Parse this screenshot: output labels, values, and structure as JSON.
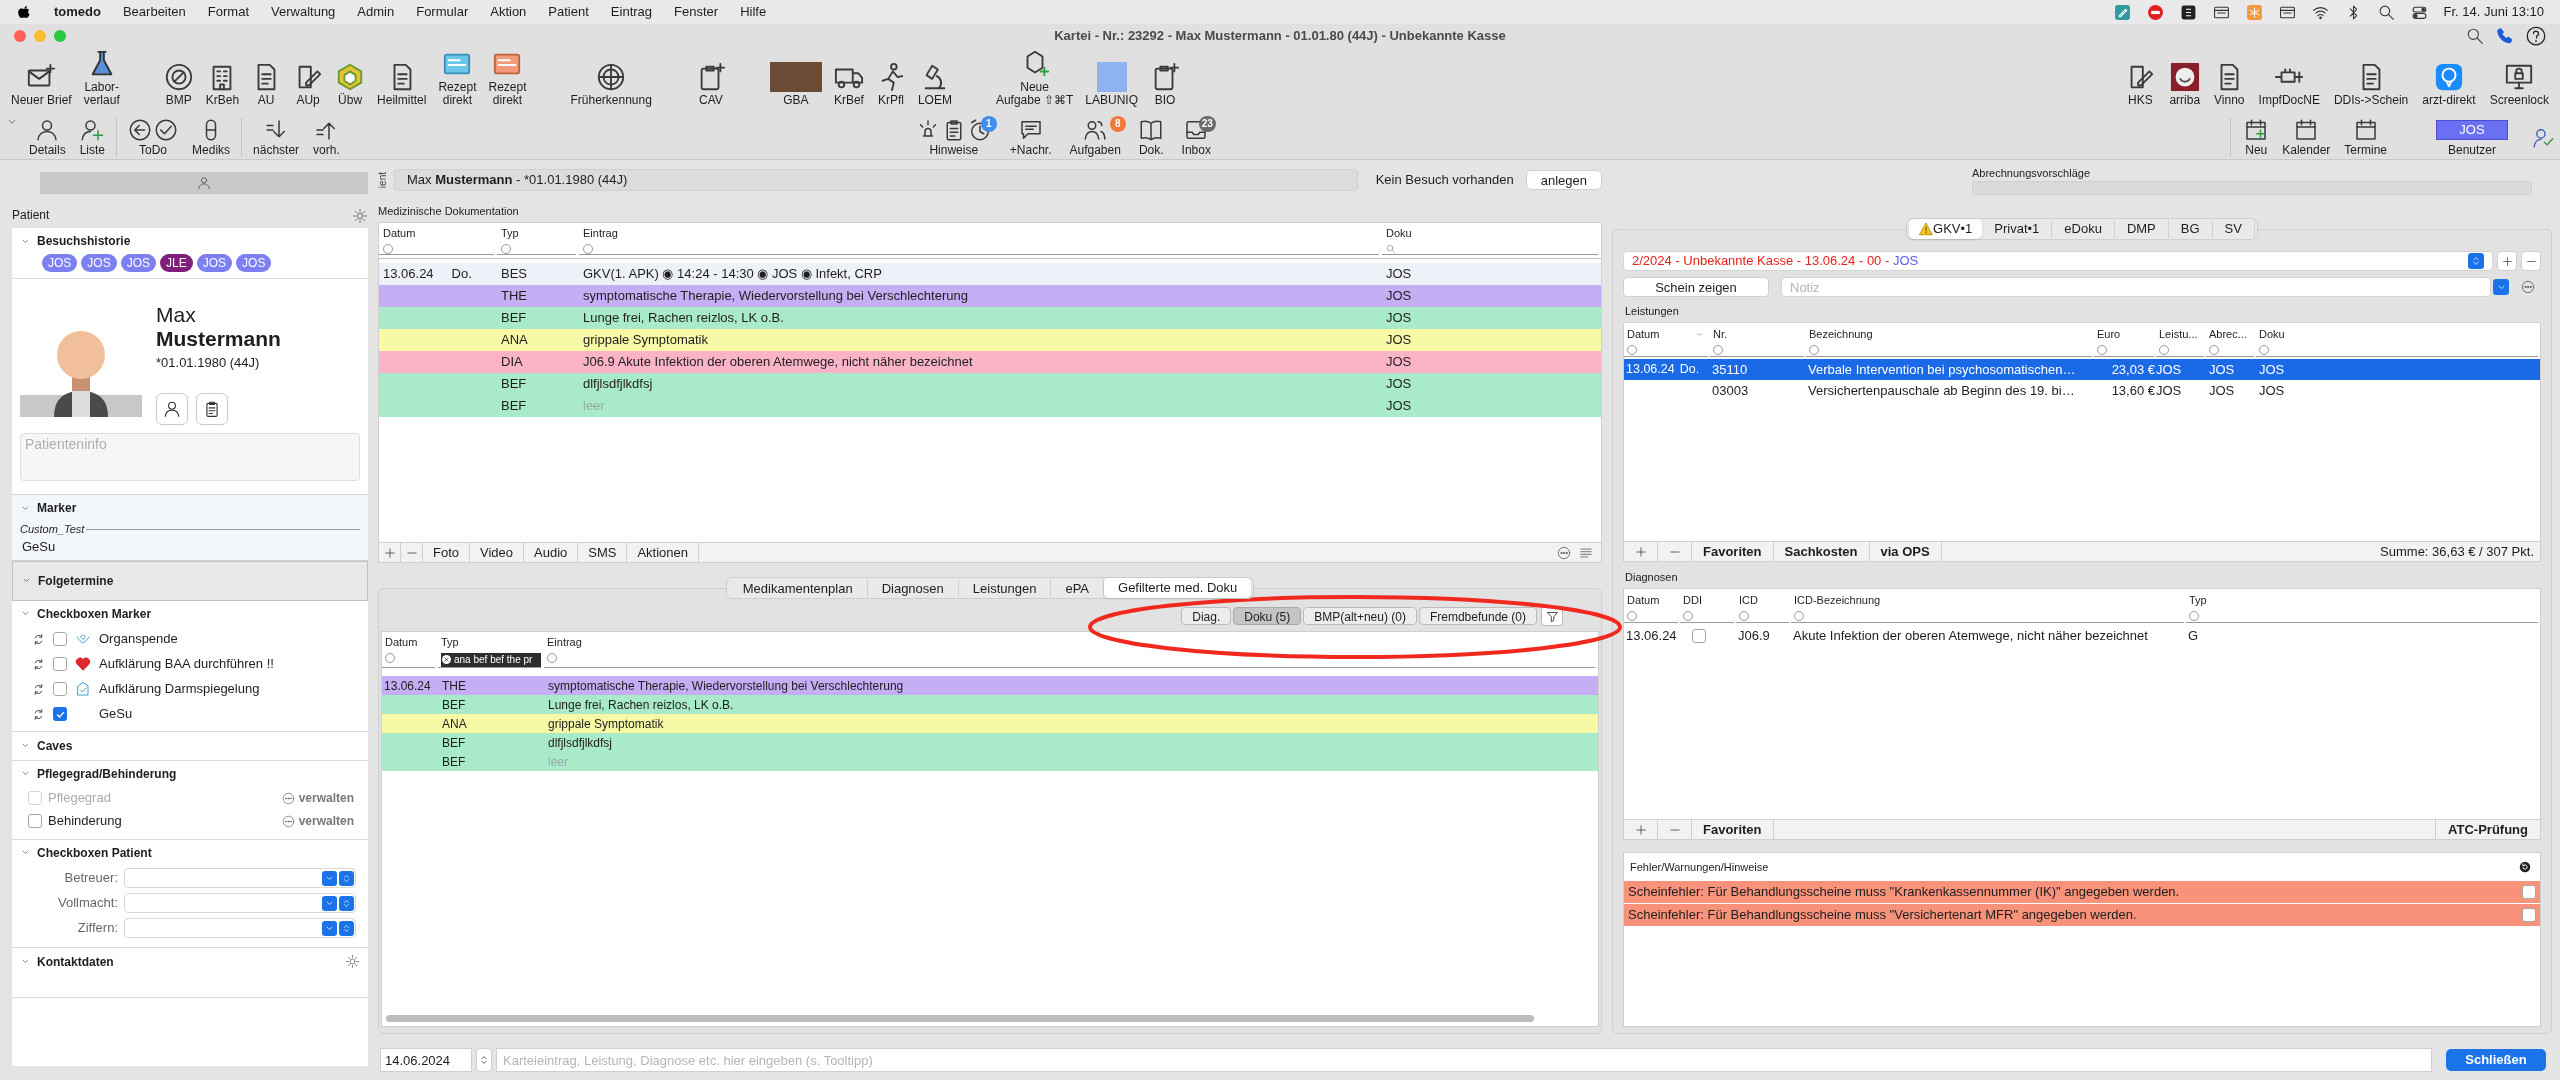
{
  "menubar": {
    "app": "tomedo",
    "items": [
      "Bearbeiten",
      "Format",
      "Verwaltung",
      "Admin",
      "Formular",
      "Aktion",
      "Patient",
      "Eintrag",
      "Fenster",
      "Hilfe"
    ],
    "clock": "Fr. 14. Juni 13:10"
  },
  "window": {
    "title": "Kartei - Nr.: 23292 - Max Mustermann - 01.01.80 (44J) - Unbekannte Kasse"
  },
  "toolbar": {
    "groups": [
      [
        {
          "label": "Neuer Brief"
        },
        {
          "label": "Labor-\nverlauf"
        }
      ],
      [
        {
          "label": "BMP"
        },
        {
          "label": "KrBeh"
        },
        {
          "label": "AU"
        },
        {
          "label": "AUp"
        },
        {
          "label": "Übw"
        },
        {
          "label": "Heilmittel"
        },
        {
          "label": "Rezept\ndirekt"
        },
        {
          "label": "Rezept\ndirekt"
        }
      ],
      [
        {
          "label": "Früherkennung"
        }
      ],
      [
        {
          "label": "CAV"
        }
      ],
      [
        {
          "label": "GBA"
        },
        {
          "label": "KrBef"
        },
        {
          "label": "KrPfl"
        },
        {
          "label": "LOEM"
        }
      ],
      [
        {
          "label": "Neue\nAufgabe ⇧⌘T"
        },
        {
          "label": "LABUNIQ"
        },
        {
          "label": "BIO"
        }
      ]
    ],
    "right": [
      {
        "label": "HKS"
      },
      {
        "label": "arriba"
      },
      {
        "label": "Vinno"
      },
      {
        "label": "ImpfDocNE"
      },
      {
        "label": "DDIs->Schein"
      },
      {
        "label": "arzt-direkt"
      },
      {
        "label": "Screenlock"
      }
    ]
  },
  "toolbar2": {
    "groups": [
      [
        {
          "label": "Details"
        },
        {
          "label": "Liste"
        }
      ],
      [
        {
          "label": "ToDo"
        },
        {
          "label": "Mediks"
        }
      ],
      [
        {
          "label": "nächster"
        },
        {
          "label": "vorh."
        }
      ]
    ],
    "center": [
      {
        "label": "Hinweise",
        "badge": "1"
      },
      {
        "label": "+Nachr."
      },
      {
        "label": "Aufgaben",
        "badge": "8"
      },
      {
        "label": "Dok."
      },
      {
        "label": "Inbox",
        "badge": "23"
      }
    ],
    "right": [
      {
        "label": "Neu"
      },
      {
        "label": "Kalender"
      },
      {
        "label": "Termine"
      }
    ],
    "user": {
      "name": "JOS",
      "label": "Benutzer"
    }
  },
  "sidebar": {
    "title": "Patient",
    "sections": [
      {
        "kind": "visits",
        "title": "Besuchshistorie",
        "expanded": true,
        "chips": [
          {
            "label": "JOS",
            "color": "#7d80f0"
          },
          {
            "label": "JOS",
            "color": "#7d80f0"
          },
          {
            "label": "JOS",
            "color": "#7d80f0"
          },
          {
            "label": "JLE",
            "color": "#801f7c"
          },
          {
            "label": "JOS",
            "color": "#7d80f0"
          },
          {
            "label": "JOS",
            "color": "#7d80f0"
          }
        ]
      },
      {
        "kind": "patient",
        "first_name": "Max",
        "last_name": "Mustermann",
        "birth": "*01.01.1980 (44J)",
        "info_placeholder": "Patienteninfo"
      },
      {
        "kind": "marker",
        "title": "Marker",
        "expanded": true,
        "label": "Custom_Test",
        "value": "GeSu"
      },
      {
        "kind": "header",
        "title": "Folgetermine",
        "expanded": true,
        "highlighted": true
      },
      {
        "kind": "checks",
        "title": "Checkboxen Marker",
        "expanded": true,
        "items": [
          {
            "label": "Organspende",
            "checked": false
          },
          {
            "label": "Aufklärung BAA durchführen !!",
            "checked": false
          },
          {
            "label": "Aufklärung Darmspiegelung",
            "checked": false
          },
          {
            "label": "GeSu",
            "checked": true
          }
        ]
      },
      {
        "kind": "header",
        "title": "Caves",
        "expanded": true,
        "highlighted": false
      },
      {
        "kind": "care",
        "title": "Pflegegrad/Behinderung",
        "expanded": true,
        "items": [
          {
            "label": "Pflegegrad",
            "checked": false,
            "disabled": true,
            "action": "verwalten"
          },
          {
            "label": "Behinderung",
            "checked": false,
            "disabled": false,
            "action": "verwalten"
          }
        ]
      },
      {
        "kind": "selects",
        "title": "Checkboxen Patient",
        "expanded": true,
        "items": [
          {
            "label": "Betreuer:"
          },
          {
            "label": "Vollmacht:"
          },
          {
            "label": "Ziffern:"
          }
        ]
      },
      {
        "kind": "header",
        "title": "Kontaktdaten",
        "expanded": true,
        "highlighted": false,
        "settings": true
      }
    ]
  },
  "patient_bar": {
    "side_label": "ient",
    "name": "Max **Mustermann** - *01.01.1980 (44J)"
  },
  "visit": {
    "text": "Kein Besuch vorhanden",
    "button": "anlegen"
  },
  "documentation": {
    "title": "Medizinische Dokumentation",
    "columns": [
      "Datum",
      "Typ",
      "Eintrag",
      "Doku"
    ],
    "rows": [
      {
        "date": "13.06.24",
        "weekday": "Do.",
        "type": "BES",
        "entry": "GKV(1. APK) ◉ 14:24 - 14:30 ◉ JOS ◉ Infekt, CRP",
        "doku": "JOS",
        "color": "#eef1f8",
        "muted": false
      },
      {
        "type": "THE",
        "entry": "symptomatische Therapie, Wiedervorstellung bei Verschlechterung",
        "doku": "JOS",
        "color": "#c6aef4",
        "muted": false
      },
      {
        "type": "BEF",
        "entry": "Lunge frei, Rachen reizlos, LK o.B.",
        "doku": "JOS",
        "color": "#a9ebc8",
        "muted": false
      },
      {
        "type": "ANA",
        "entry": "grippale Symptomatik",
        "doku": "JOS",
        "color": "#f7f9a6",
        "muted": false
      },
      {
        "type": "DIA",
        "entry": "J06.9 Akute Infektion der oberen Atemwege, nicht näher bezeichnet",
        "doku": "JOS",
        "color": "#fbb3c8",
        "muted": false
      },
      {
        "type": "BEF",
        "entry": "dlfjlsdfjlkdfsj",
        "doku": "JOS",
        "color": "#a9ebc8",
        "muted": false
      },
      {
        "type": "BEF",
        "entry": "leer",
        "doku": "JOS",
        "color": "#a9ebc8",
        "muted": true
      }
    ],
    "toolbar": [
      "Foto",
      "Video",
      "Audio",
      "SMS",
      "Aktionen"
    ]
  },
  "lower_tabs": [
    {
      "label": "Medikamentenplan",
      "selected": false
    },
    {
      "label": "Diagnosen",
      "selected": false
    },
    {
      "label": "Leistungen",
      "selected": false
    },
    {
      "label": "ePA",
      "selected": false
    },
    {
      "label": "Gefilterte med. Doku",
      "selected": true
    }
  ],
  "filters": [
    {
      "label": "Diag.",
      "selected": false
    },
    {
      "label": "Doku (5)",
      "selected": true
    },
    {
      "label": "BMP(alt+neu) (0)",
      "selected": false
    },
    {
      "label": "Fremdbefunde (0)",
      "selected": false
    }
  ],
  "filtered_doku": {
    "columns": [
      "Datum",
      "Typ",
      "Eintrag"
    ],
    "type_filter": "ana bef bef the pr",
    "rows": [
      {
        "date": "13.06.24",
        "type": "THE",
        "entry": "symptomatische Therapie, Wiedervorstellung bei Verschlechterung",
        "color": "#c6aef4",
        "muted": false
      },
      {
        "type": "BEF",
        "entry": "Lunge frei, Rachen reizlos, LK o.B.",
        "color": "#a9ebc8",
        "muted": false
      },
      {
        "type": "ANA",
        "entry": "grippale Symptomatik",
        "color": "#f7f9a6",
        "muted": false
      },
      {
        "type": "BEF",
        "entry": "dlfjlsdfjlkdfsj",
        "color": "#a9ebc8",
        "muted": false
      },
      {
        "type": "BEF",
        "entry": "leer",
        "color": "#a9ebc8",
        "muted": true
      }
    ]
  },
  "entry_bar": {
    "date": "14.06.2024",
    "placeholder": "Karteieintrag, Leistung, Diagnose etc. hier eingeben (s. Tooltipp)",
    "button": "Schließen"
  },
  "billing_suggestions": {
    "title": "Abrechnungsvorschläge"
  },
  "schein_tabs": [
    {
      "label": "GKV•1",
      "selected": true,
      "warning": true
    },
    {
      "label": "Privat•1",
      "selected": false,
      "warning": false
    },
    {
      "label": "eDoku",
      "selected": false,
      "warning": false
    },
    {
      "label": "DMP",
      "selected": false,
      "warning": false
    },
    {
      "label": "BG",
      "selected": false,
      "warning": false
    },
    {
      "label": "SV",
      "selected": false,
      "warning": false
    }
  ],
  "schein": {
    "text": "2/2024 - Unbekannte Kasse - 13.06.24 - 00 - ",
    "user": "JOS",
    "show_button": "Schein zeigen",
    "note_placeholder": "Notiz"
  },
  "leistungen": {
    "title": "Leistungen",
    "columns": [
      "Datum",
      "Nr.",
      "Bezeichnung",
      "Euro",
      "Leistu...",
      "Abrec...",
      "Doku"
    ],
    "rows": [
      {
        "date": "13.06.24",
        "weekday": "Do.",
        "nr": "35110",
        "name": "Verbale Intervention bei psychosomatischen…",
        "euro": "23,03 €",
        "column_5": "JOS",
        "abrec": "JOS",
        "doku": "JOS",
        "selected": true
      },
      {
        "nr": "03003",
        "name": "Versichertenpauschale ab Beginn des 19. bi…",
        "euro": "13,60 €",
        "column_5": "JOS",
        "abrec": "JOS",
        "doku": "JOS",
        "selected": false
      }
    ],
    "footer": [
      "Favoriten",
      "Sachkosten",
      "via OPS"
    ],
    "sum": "Summe: 36,63 € / 307 Pkt."
  },
  "diagnosen": {
    "title": "Diagnosen",
    "columns": [
      "Datum",
      "DDI",
      "ICD",
      "ICD-Bezeichnung",
      "Typ"
    ],
    "rows": [
      {
        "date": "13.06.24",
        "ddi": false,
        "icd": "J06.9",
        "name": "Akute Infektion der oberen Atemwege, nicht näher bezeichnet",
        "type": "G"
      }
    ],
    "footer": [
      "Favoriten"
    ],
    "check_button": "ATC-Prüfung"
  },
  "issues": {
    "title": "Fehler/Warnungen/Hinweise",
    "rows": [
      {
        "text": "Scheinfehler: Für Behandlungsscheine muss \"Krankenkassennummer (IK)\" angegeben werden.",
        "checked": false
      },
      {
        "text": "Scheinfehler: Für Behandlungsscheine muss \"Versichertenart MFR\" angegeben werden.",
        "checked": false
      }
    ]
  }
}
